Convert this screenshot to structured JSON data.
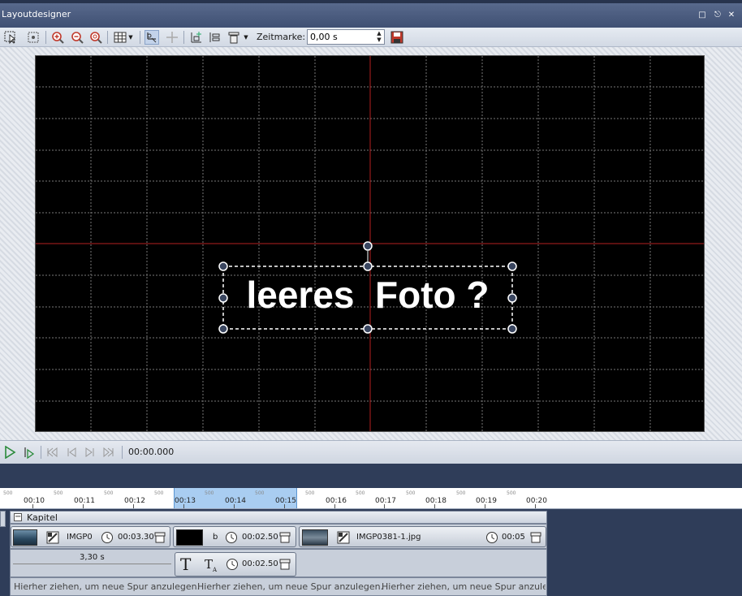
{
  "window": {
    "title": "Layoutdesigner"
  },
  "toolbar": {
    "zeitmarke_label": "Zeitmarke:",
    "zeitmarke_value": "0,00 s"
  },
  "stage": {
    "text_object": "leeres  Foto ?"
  },
  "playback": {
    "timecode": "00:00.000"
  },
  "ruler": {
    "labels": [
      "00:10",
      "00:11",
      "00:12",
      "00:13",
      "00:14",
      "00:15",
      "00:16",
      "00:17",
      "00:18",
      "00:19",
      "00:20"
    ],
    "sublabel": "500"
  },
  "timeline": {
    "chapter_label": "Kapitel",
    "clips": [
      {
        "name": "IMGP0",
        "duration": "00:03.30"
      },
      {
        "name": "b",
        "duration": "00:02.50"
      },
      {
        "name": "IMGP0381-1.jpg",
        "duration": "00:05"
      }
    ],
    "range_duration": "3,30 s",
    "text_clip_duration": "00:02.50",
    "drop_hint": "Hierher ziehen, um neue Spur anzulegen.",
    "drop_hint_truncated": "Hierher ziehen, um neue Spur anzulege..."
  }
}
